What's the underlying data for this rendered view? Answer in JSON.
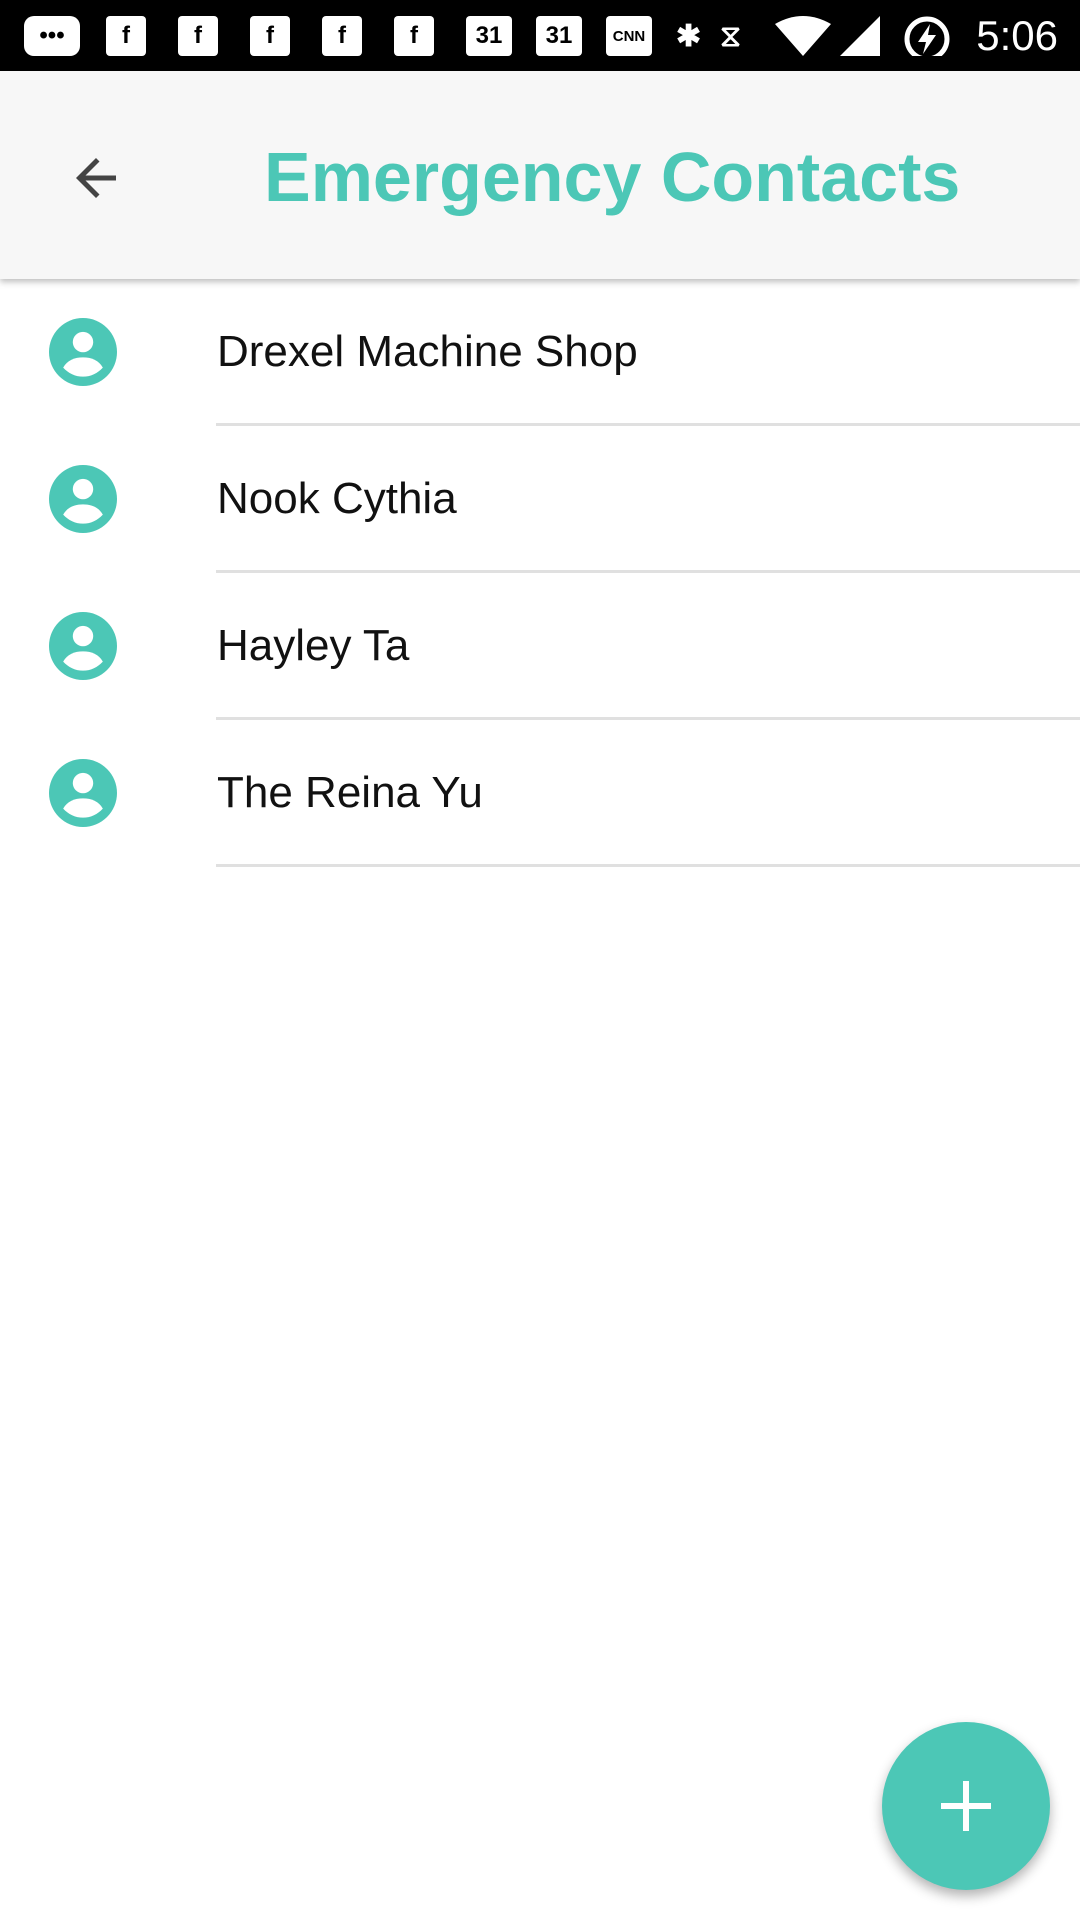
{
  "status_bar": {
    "time": "5:06",
    "icons": [
      "messages-icon",
      "facebook-icon",
      "facebook-icon",
      "facebook-icon",
      "facebook-icon",
      "facebook-icon",
      "calendar-icon",
      "calendar-icon",
      "cnn-icon",
      "bluetooth-icon",
      "vibrate-icon",
      "wifi-icon",
      "signal-icon",
      "battery-charging-icon"
    ],
    "calendar_day": "31",
    "cnn": "CNN",
    "fb": "f"
  },
  "header": {
    "title": "Emergency Contacts"
  },
  "contacts": [
    {
      "name": "Drexel Machine Shop"
    },
    {
      "name": "Nook Cythia"
    },
    {
      "name": "Hayley Ta"
    },
    {
      "name": "The Reina Yu"
    }
  ],
  "colors": {
    "accent": "#4cc7b6"
  }
}
